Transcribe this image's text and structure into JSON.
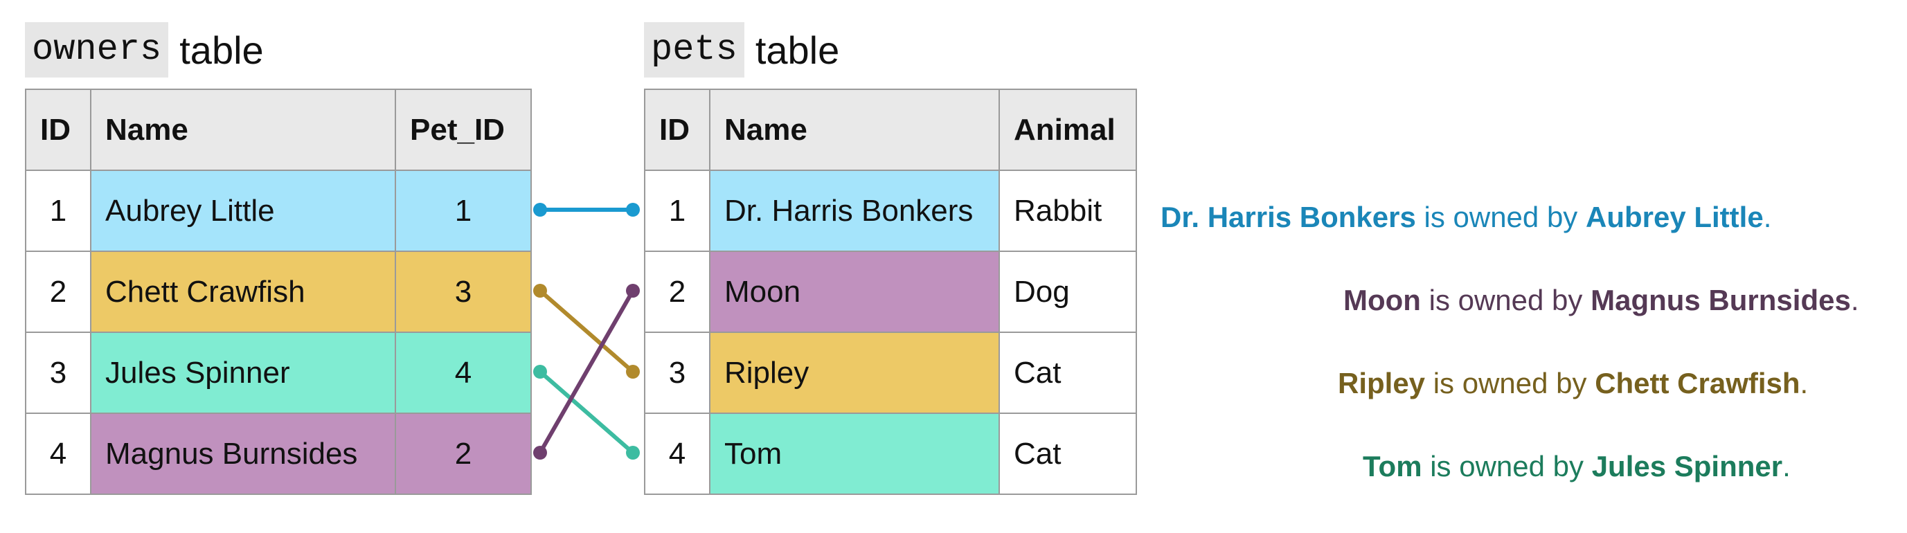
{
  "owners": {
    "caption_code": "owners",
    "caption_word": "table",
    "headers": [
      "ID",
      "Name",
      "Pet_ID"
    ],
    "rows": [
      {
        "id": "1",
        "name": "Aubrey Little",
        "pet_id": "1",
        "color": "#a5e4fb"
      },
      {
        "id": "2",
        "name": "Chett Crawfish",
        "pet_id": "3",
        "color": "#edc966"
      },
      {
        "id": "3",
        "name": "Jules Spinner",
        "pet_id": "4",
        "color": "#80ecd2"
      },
      {
        "id": "4",
        "name": "Magnus Burnsides",
        "pet_id": "2",
        "color": "#c091be"
      }
    ]
  },
  "pets": {
    "caption_code": "pets",
    "caption_word": "table",
    "headers": [
      "ID",
      "Name",
      "Animal"
    ],
    "rows": [
      {
        "id": "1",
        "name": "Dr. Harris Bonkers",
        "animal": "Rabbit",
        "color": "#a5e4fb"
      },
      {
        "id": "2",
        "name": "Moon",
        "animal": "Dog",
        "color": "#c091be"
      },
      {
        "id": "3",
        "name": "Ripley",
        "animal": "Cat",
        "color": "#edc966"
      },
      {
        "id": "4",
        "name": "Tom",
        "animal": "Cat",
        "color": "#80ecd2"
      }
    ]
  },
  "links": [
    {
      "owner_row": 1,
      "pet_row": 1,
      "color": "#1a9ad0"
    },
    {
      "owner_row": 2,
      "pet_row": 3,
      "color": "#b18a2c"
    },
    {
      "owner_row": 3,
      "pet_row": 4,
      "color": "#3dbca1"
    },
    {
      "owner_row": 4,
      "pet_row": 2,
      "color": "#6f3f6e"
    }
  ],
  "statements": [
    {
      "pet": "Dr. Harris Bonkers",
      "middle": " is owned by ",
      "owner": "Aubrey Little",
      "end": ".",
      "color": "#1a86b8"
    },
    {
      "pet": "Moon",
      "middle": " is owned by ",
      "owner": "Magnus Burnsides",
      "end": ".",
      "color": "#553955"
    },
    {
      "pet": "Ripley",
      "middle": " is owned by ",
      "owner": "Chett Crawfish",
      "end": ".",
      "color": "#76601e"
    },
    {
      "pet": "Tom",
      "middle": " is owned by ",
      "owner": "Jules Spinner",
      "end": ".",
      "color": "#1c7c5c"
    }
  ]
}
